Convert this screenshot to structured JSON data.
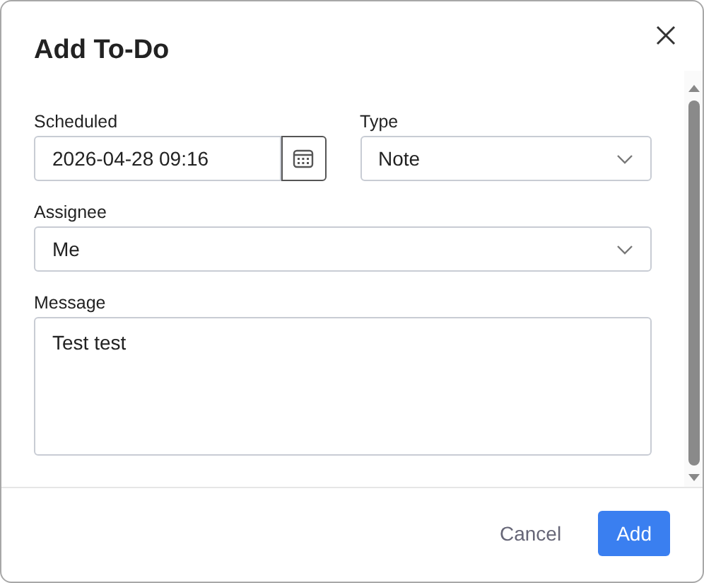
{
  "dialog": {
    "title": "Add To-Do"
  },
  "rows": [
    [
      {
        "kind": "date",
        "label": "Scheduled",
        "value": "2026-04-28 09:16"
      },
      {
        "kind": "select",
        "label": "Type",
        "value": "Note"
      }
    ],
    [
      {
        "kind": "select",
        "label": "Assignee",
        "value": "Me"
      }
    ],
    [
      {
        "kind": "textarea",
        "label": "Message",
        "value": "Test test"
      }
    ]
  ],
  "buttons": [
    {
      "label": "Cancel",
      "kind": "secondary"
    },
    {
      "label": "Add",
      "kind": "primary"
    }
  ]
}
